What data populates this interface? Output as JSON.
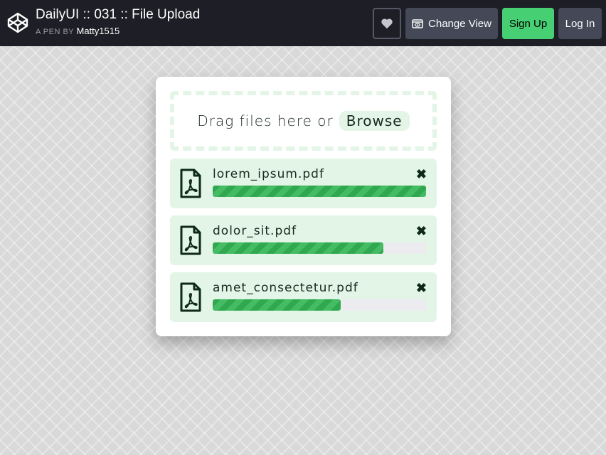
{
  "header": {
    "title": "DailyUI :: 031 :: File Upload",
    "pen_by": "A PEN BY",
    "author": "Matty1515",
    "buttons": {
      "heart_icon": "heart-icon",
      "change_view": "Change View",
      "sign_up": "Sign Up",
      "log_in": "Log In"
    },
    "colors": {
      "bar": "#1e1f26",
      "sign_up": "#47cf73",
      "button": "#444857"
    }
  },
  "uploader": {
    "drop_text": "Drag files here or",
    "browse": "Browse",
    "close_glyph": "✖",
    "files": [
      {
        "name": "lorem_ipsum.pdf",
        "progress": 1.0
      },
      {
        "name": "dolor_sit.pdf",
        "progress": 0.8
      },
      {
        "name": "amet_consectetur.pdf",
        "progress": 0.6
      }
    ],
    "colors": {
      "accent": "#2fa84f",
      "item_bg": "#e3f5e6",
      "icon": "#0e2a16"
    }
  }
}
